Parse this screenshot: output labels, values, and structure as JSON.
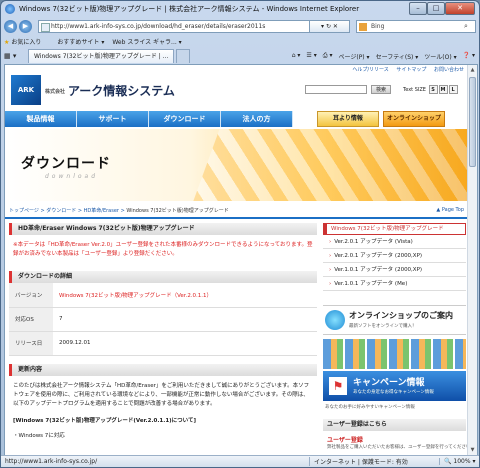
{
  "window": {
    "title": "Windows 7(32ビット版)物理アップグレード | 株式会社アーク情報システム - Windows Internet Explorer",
    "minimize": "–",
    "maximize": "□",
    "close": "✕"
  },
  "addressbar": {
    "url": "http://www1.ark-info-sys.co.jp/download/hd_eraser/details/eraser2011s",
    "controls": "▾ ↻ ✕",
    "search_label": "Bing"
  },
  "favbar": {
    "favorites": "お気に入り",
    "suggested": "おすすめサイト ▾",
    "webslice": "Web スライス ギャラ... ▾"
  },
  "tabs": {
    "active": "Windows 7(32ビット版)物理アップグレード | ...",
    "new_tab": ""
  },
  "commands": {
    "page": "ページ(P) ▾",
    "safety": "セーフティ(S) ▾",
    "tools": "ツール(O) ▾",
    "help": "❓ ▾"
  },
  "site": {
    "toplinks": [
      "ヘルプ/リリース",
      "サイトマップ",
      "お問い合わせ"
    ],
    "logo_mark": "ARK",
    "company_prefix": "株式会社",
    "company_name": "アーク情報システム",
    "search_button": "検索",
    "textsize_label": "Text SIZE",
    "textsize_options": [
      "S",
      "M",
      "L"
    ],
    "nav": [
      "製品情報",
      "サポート",
      "ダウンロード",
      "法人の方"
    ],
    "news_button": "耳より情報",
    "shop_button": "オンラインショップ"
  },
  "hero": {
    "title": "ダウンロード",
    "subtitle": "download"
  },
  "breadcrumb": {
    "items": [
      "トップページ",
      "ダウンロード",
      "HD革命/Eraser"
    ],
    "current": "Windows 7(32ビット版)物理アップグレード",
    "page_top": "▲ Page Top"
  },
  "main": {
    "heading": "HD革命/Eraser Windows 7(32ビット版)物理アップグレード",
    "notice": "※本データは「HD革命/Eraser Ver.2.0」ユーザー登録をされた本番様のみダウンロードできるようになっております。登録がお済みでない本製品は「ユーザー登録」より登録だください。",
    "details_heading": "ダウンロードの詳細",
    "details": [
      {
        "key": "バージョン",
        "value": "Windows 7(32ビット版)物理アップグレード（Ver.2.0.1.1）"
      },
      {
        "key": "対応OS",
        "value": "7"
      },
      {
        "key": "リリース日",
        "value": "2009.12.01"
      }
    ],
    "update_heading": "更新内容",
    "update_text": "このたびは株式会社アーク情報システム「HD革命/Eraser」をご利用いただきまして誠にありがとうございます。本ソフトウェアを使用の際に、ご利用されている環境などにより、一部機能が正常に動作しない場合がございます。その際は、以下のアップデートプログラムを適用することで問題が改善する場合があります。",
    "update_bold": "[Windows 7(32ビット版)物理アップグレード(Ver.2.0.1.1)について]",
    "update_item": "・Windows 7に対応"
  },
  "sidebar": {
    "current": "Windows 7(32ビット版)物理アップグレード",
    "items": [
      "Ver.2.0.1 アップデータ (Vista)",
      "Ver.2.0.1 アップデータ (2000,XP)",
      "Ver.1.0.1 アップデータ (2000,XP)",
      "Ver.1.0.1 アップデータ (Me)"
    ],
    "shop_title": "オンラインショップのご案内",
    "shop_sub": "最新ソフトをオンラインで購入！",
    "campaign_title": "キャンペーン情報",
    "campaign_sub": "あなたの身近なお得なキャンペーン情報",
    "campaign_caption": "あなたのお手に好みやすいキャンペーン情報",
    "register_heading": "ユーザー登録はこちら",
    "register_title": "ユーザー登録",
    "register_text": "弊社製品をご購入いただいたお客様は、ユーザー登録を行ってください。"
  },
  "status": {
    "url": "http://www1.ark-info-sys.co.jp/",
    "zone": "インターネット | 保護モード: 有効",
    "zoom": "🔍 100% ▾"
  }
}
